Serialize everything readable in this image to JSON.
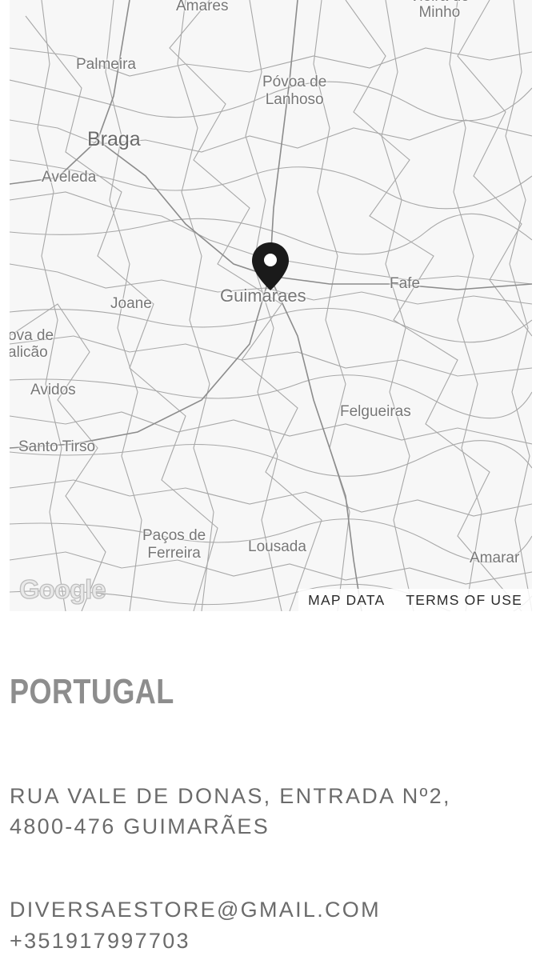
{
  "map": {
    "places": {
      "amares": "Amares",
      "vieira_do_minho": "Vieira do\nMinho",
      "palmeira": "Palmeira",
      "povoa_de_lanhoso": "Póvoa de\nLanhoso",
      "braga": "Braga",
      "aveleda": "Aveleda",
      "guimaraes": "Guimaraes",
      "fafe": "Fafe",
      "joane": "Joane",
      "vila_nova_de_famalicao": "ova de\nalicão",
      "avidos": "Avidos",
      "felgueiras": "Felgueiras",
      "santo_tirso": "Santo Tirso",
      "pacos_de_ferreira": "Paços de\nFerreira",
      "lousada": "Lousada",
      "amarante": "Amarar"
    },
    "marker_icon": "location-pin-icon",
    "logo": "Google",
    "links": {
      "map_data": "MAP DATA",
      "terms": "TERMS OF USE"
    }
  },
  "contact": {
    "country": "PORTUGAL",
    "address": "RUA VALE DE DONAS, ENTRADA Nº2, 4800-476 GUIMARÃES",
    "email": "DIVERSAESTORE@GMAIL.COM",
    "phone": "+351917997703"
  },
  "colors": {
    "map_background": "#f7f7f7",
    "road": "#9a9a9a",
    "label": "#777777",
    "marker": "#1a1a1a",
    "text": "#6b6b6b"
  }
}
